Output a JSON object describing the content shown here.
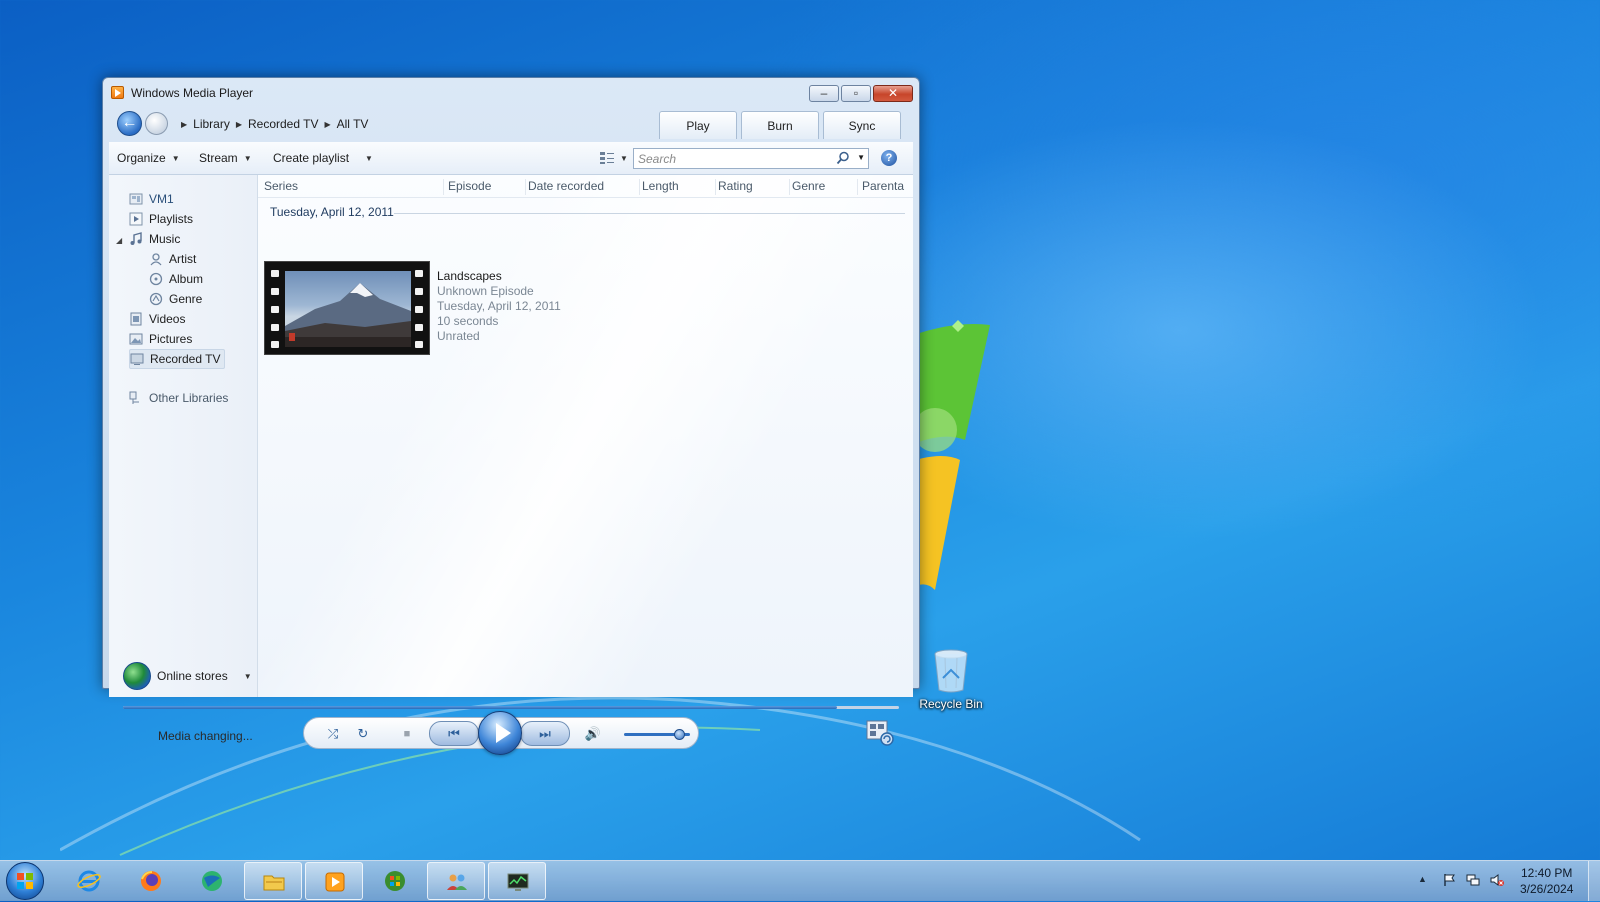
{
  "window": {
    "title": "Windows Media Player",
    "caption": {
      "minimize": "–",
      "maximize": "▫",
      "close": "✕"
    }
  },
  "breadcrumb": [
    "Library",
    "Recorded TV",
    "All TV"
  ],
  "tabs": [
    "Play",
    "Burn",
    "Sync"
  ],
  "toolbar": {
    "organize": "Organize",
    "stream": "Stream",
    "create_playlist": "Create playlist",
    "search_placeholder": "Search",
    "help": "?"
  },
  "nav_tree": {
    "user": "VM1",
    "playlists": "Playlists",
    "music": "Music",
    "artist": "Artist",
    "album": "Album",
    "genre": "Genre",
    "videos": "Videos",
    "pictures": "Pictures",
    "recorded_tv": "Recorded TV",
    "other_libraries": "Other Libraries",
    "online_stores": "Online stores"
  },
  "columns": [
    "Series",
    "Episode",
    "Date recorded",
    "Length",
    "Rating",
    "Genre",
    "Parenta"
  ],
  "group": {
    "header": "Tuesday, April 12, 2011"
  },
  "media": {
    "title": "Landscapes",
    "episode": "Unknown Episode",
    "date": "Tuesday, April 12, 2011",
    "length": "10 seconds",
    "rating": "Unrated"
  },
  "player": {
    "status": "Media changing...",
    "seek_progress": 0.92,
    "volume_level": 0.85
  },
  "desktop": {
    "recycle_bin": "Recycle Bin"
  },
  "taskbar": {
    "time": "12:40 PM",
    "date": "3/26/2024"
  },
  "colors": {
    "accent": "#2a6ab8",
    "desktop": "#1a86de"
  }
}
